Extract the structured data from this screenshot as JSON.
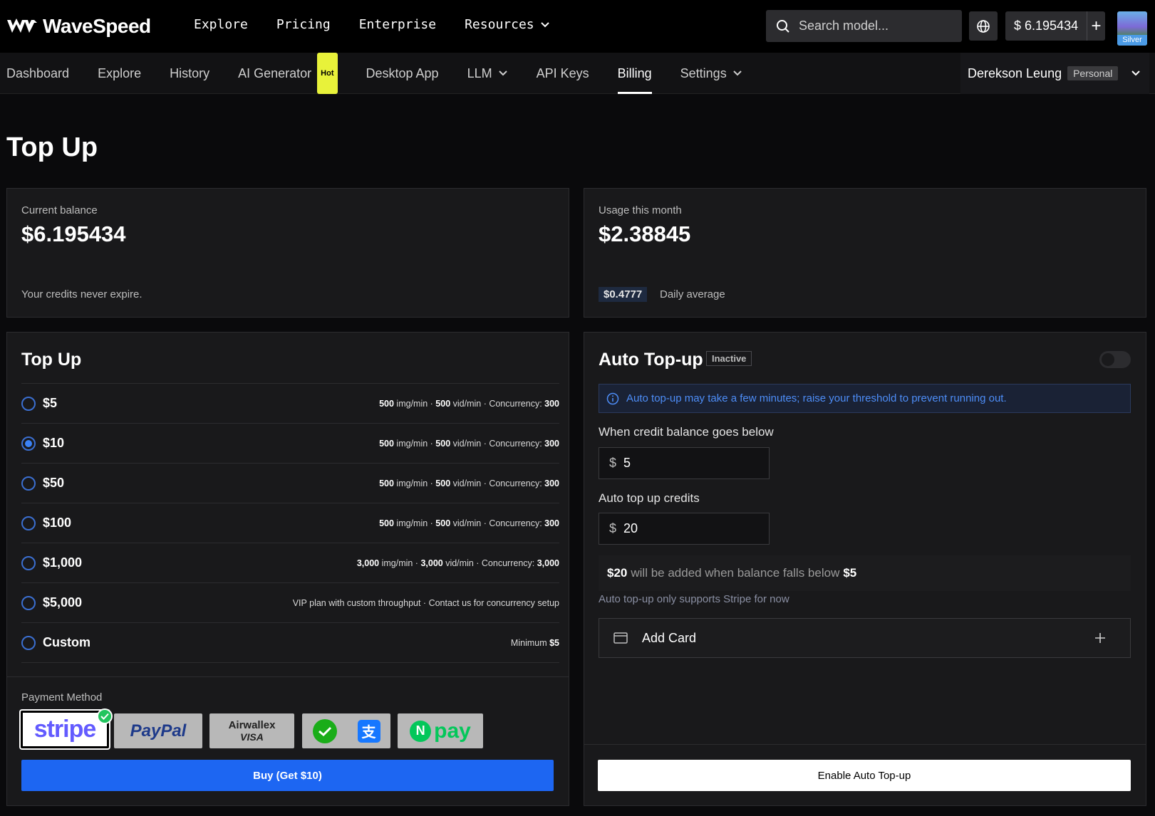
{
  "brand": {
    "name": "WaveSpeed"
  },
  "topnav": {
    "explore": "Explore",
    "pricing": "Pricing",
    "enterprise": "Enterprise",
    "resources": "Resources"
  },
  "search": {
    "placeholder": "Search model..."
  },
  "header": {
    "balance": "$ 6.195434",
    "plus": "+",
    "tier": "Silver"
  },
  "subnav": {
    "dashboard": "Dashboard",
    "explore": "Explore",
    "history": "History",
    "ai_generator": "AI Generator",
    "hot": "Hot",
    "desktop_app": "Desktop App",
    "llm": "LLM",
    "api_keys": "API Keys",
    "billing": "Billing",
    "settings": "Settings"
  },
  "user": {
    "name": "Derekson Leung",
    "account_type": "Personal"
  },
  "page": {
    "title": "Top Up"
  },
  "balance_card": {
    "label": "Current balance",
    "value": "$6.195434",
    "note": "Your credits never expire."
  },
  "usage_card": {
    "label": "Usage this month",
    "value": "$2.38845",
    "daily_value": "$0.4777",
    "daily_label": "Daily average"
  },
  "topup": {
    "title": "Top Up",
    "tiers": [
      {
        "price": "$5",
        "parts": [
          "500",
          " img/min · ",
          "500",
          " vid/min · Concurrency: ",
          "300"
        ],
        "selected": false
      },
      {
        "price": "$10",
        "parts": [
          "500",
          " img/min · ",
          "500",
          " vid/min · Concurrency: ",
          "300"
        ],
        "selected": true
      },
      {
        "price": "$50",
        "parts": [
          "500",
          " img/min · ",
          "500",
          " vid/min · Concurrency: ",
          "300"
        ],
        "selected": false
      },
      {
        "price": "$100",
        "parts": [
          "500",
          " img/min · ",
          "500",
          " vid/min · Concurrency: ",
          "300"
        ],
        "selected": false
      },
      {
        "price": "$1,000",
        "parts": [
          "3,000",
          " img/min · ",
          "3,000",
          " vid/min · Concurrency: ",
          "3,000"
        ],
        "selected": false
      },
      {
        "price": "$5,000",
        "plain": "VIP plan with custom throughput · Contact us for concurrency setup",
        "selected": false
      },
      {
        "price": "Custom",
        "minimum_prefix": "Minimum ",
        "minimum_value": "$5",
        "selected": false
      }
    ],
    "payment_label": "Payment Method",
    "payment_methods": {
      "stripe": "stripe",
      "paypal": "PayPal",
      "airwallex": "Airwallex",
      "visa": "VISA",
      "npay": "pay"
    },
    "buy_label": "Buy (Get $10)"
  },
  "auto": {
    "title": "Auto Top-up",
    "status": "Inactive",
    "toggle_on": false,
    "info": "Auto top-up may take a few minutes; raise your threshold to prevent running out.",
    "threshold_label": "When credit balance goes below",
    "threshold_value": "5",
    "credits_label": "Auto top up credits",
    "credits_value": "20",
    "currency": "$",
    "summary_amount": "$20",
    "summary_mid": "will be added when balance falls below",
    "summary_threshold": "$5",
    "stripe_note": "Auto top-up only supports Stripe for now",
    "add_card": "Add Card",
    "enable_label": "Enable Auto Top-up"
  },
  "colors": {
    "accent": "#1d66f2",
    "hot_badge": "#e8f23a",
    "info_text": "#4d8df7",
    "selected_check": "#22c55e"
  }
}
